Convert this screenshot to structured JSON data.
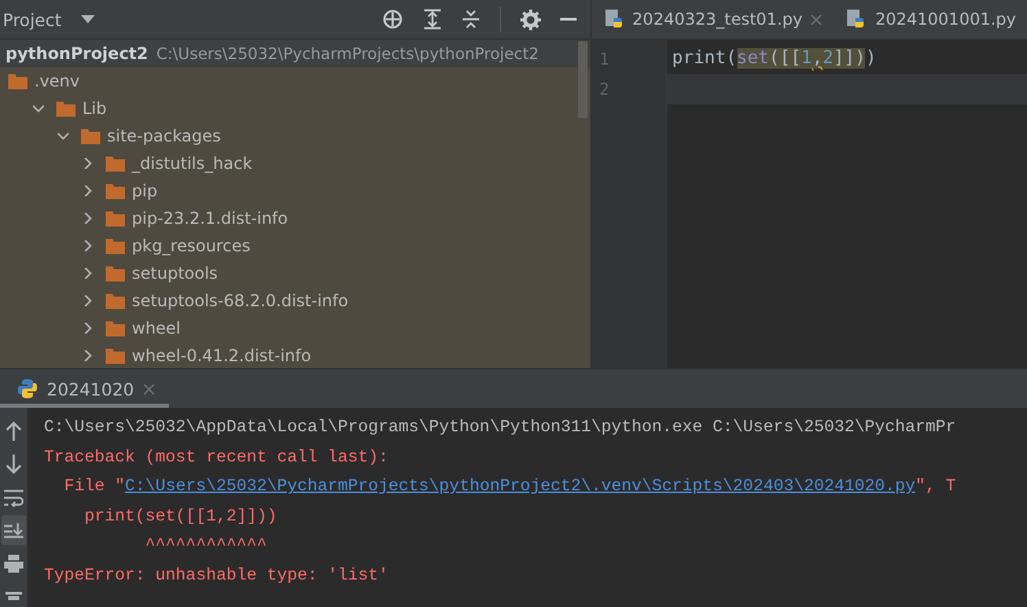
{
  "project_panel": {
    "title": "Project",
    "root": {
      "name": "pythonProject2",
      "path": "C:\\Users\\25032\\PycharmProjects\\pythonProject2",
      "selected": true
    },
    "tree": [
      {
        "name": ".venv",
        "children": [
          {
            "name": "Lib",
            "expanded": true,
            "children": [
              {
                "name": "site-packages",
                "expanded": true,
                "children": [
                  {
                    "name": "_distutils_hack",
                    "expanded": false
                  },
                  {
                    "name": "pip",
                    "expanded": false
                  },
                  {
                    "name": "pip-23.2.1.dist-info",
                    "expanded": false
                  },
                  {
                    "name": "pkg_resources",
                    "expanded": false
                  },
                  {
                    "name": "setuptools",
                    "expanded": false
                  },
                  {
                    "name": "setuptools-68.2.0.dist-info",
                    "expanded": false
                  },
                  {
                    "name": "wheel",
                    "expanded": false
                  },
                  {
                    "name": "wheel-0.41.2.dist-info",
                    "expanded": false
                  }
                ]
              }
            ]
          }
        ]
      }
    ]
  },
  "editor": {
    "tabs": [
      {
        "label": "20240323_test01.py",
        "selected": false,
        "closable": true
      },
      {
        "label": "20241001001.py",
        "selected": false,
        "closable": false
      }
    ],
    "lines": [
      {
        "number": "1",
        "current": false,
        "tokens": [
          {
            "text": "print",
            "kind": "func",
            "highlighted": false,
            "warning": false
          },
          {
            "text": "(",
            "kind": "punct",
            "highlighted": false,
            "warning": false
          },
          {
            "text": "set",
            "kind": "builtin",
            "highlighted": true,
            "warning": false
          },
          {
            "text": "([[",
            "kind": "punct",
            "highlighted": true,
            "warning": false
          },
          {
            "text": "1",
            "kind": "number",
            "highlighted": true,
            "warning": false
          },
          {
            "text": ",",
            "kind": "punct",
            "highlighted": true,
            "warning": true
          },
          {
            "text": "2",
            "kind": "number",
            "highlighted": true,
            "warning": false
          },
          {
            "text": "]])",
            "kind": "punct",
            "highlighted": true,
            "warning": false
          },
          {
            "text": ")",
            "kind": "punct",
            "highlighted": false,
            "warning": false
          }
        ]
      },
      {
        "number": "2",
        "current": true
      }
    ]
  },
  "run_panel": {
    "tabs": [
      {
        "label": "20241020",
        "selected": true
      }
    ],
    "console": [
      {
        "kind": "info",
        "text": "C:\\Users\\25032\\AppData\\Local\\Programs\\Python\\Python311\\python.exe C:\\Users\\25032\\PycharmPr"
      },
      {
        "kind": "error",
        "text": "Traceback (most recent call last):"
      },
      {
        "kind": "file",
        "prefix": "  File \"",
        "link": "C:\\Users\\25032\\PycharmProjects\\pythonProject2\\.venv\\Scripts\\202403\\20241020.py",
        "suffix": "\", T"
      },
      {
        "kind": "error",
        "text": "    print(set([[1,2]]))"
      },
      {
        "kind": "error",
        "text": "          ^^^^^^^^^^^^"
      },
      {
        "kind": "error",
        "text": "TypeError: unhashable type: 'list'"
      }
    ],
    "toolbar": [
      {
        "kind": "up",
        "on": false
      },
      {
        "kind": "down",
        "on": false
      },
      {
        "kind": "wrap",
        "on": false
      },
      {
        "kind": "scroll-end",
        "on": true
      },
      {
        "kind": "print",
        "on": false
      },
      {
        "kind": "trash",
        "on": false
      }
    ]
  }
}
